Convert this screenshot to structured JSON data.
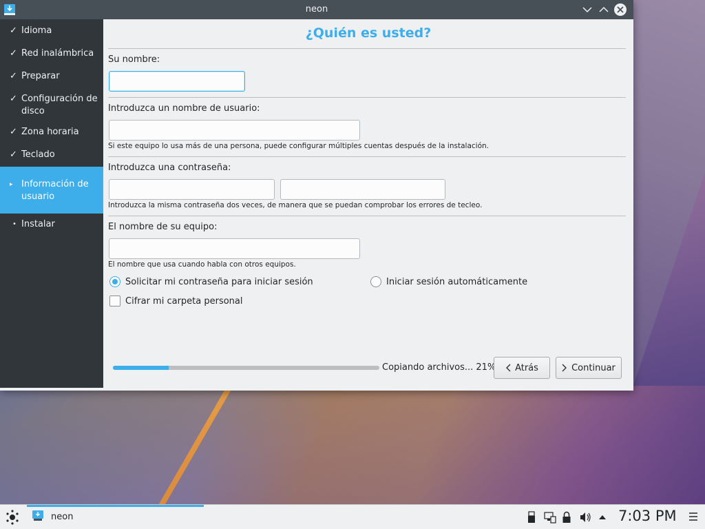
{
  "window": {
    "title": "neon"
  },
  "sidebar": {
    "steps": [
      {
        "label": "Idioma",
        "mark": "✓"
      },
      {
        "label": "Red inalámbrica",
        "mark": "✓"
      },
      {
        "label": "Preparar",
        "mark": "✓"
      },
      {
        "label": "Configuración de disco",
        "mark": "✓"
      },
      {
        "label": "Zona horaria",
        "mark": "✓"
      },
      {
        "label": "Teclado",
        "mark": "✓"
      },
      {
        "label": "Información de usuario",
        "mark": "▸"
      },
      {
        "label": "Instalar",
        "mark": "•"
      }
    ]
  },
  "page": {
    "heading": "¿Quién es usted?",
    "name_label": "Su nombre:",
    "name_value": "",
    "username_label": "Introduzca un nombre de usuario:",
    "username_value": "",
    "username_hint": "Si este equipo lo usa más de una persona, puede configurar múltiples cuentas después de la instalación.",
    "password_label": "Introduzca una contraseña:",
    "password_value": "",
    "password_confirm_value": "",
    "password_hint": "Introduzca la misma contraseña dos veces, de manera que se puedan comprobar los errores de tecleo.",
    "hostname_label": "El nombre de su equipo:",
    "hostname_value": "",
    "hostname_hint": "El nombre que usa cuando habla con otros equipos.",
    "radio_ask_password": "Solicitar mi contraseña para iniciar sesión",
    "radio_autologin": "Iniciar sesión automáticamente",
    "checkbox_encrypt": "Cifrar mi carpeta personal",
    "ask_password_selected": true,
    "encrypt_checked": false
  },
  "footer": {
    "progress_text": "Copiando archivos... 21%",
    "progress_fraction": 0.21,
    "back_label": "Atrás",
    "next_label": "Continuar"
  },
  "taskbar": {
    "task_label": "neon",
    "clock": "7:03 PM"
  },
  "colors": {
    "accent": "#3daee9",
    "sidebar_bg": "#31363b",
    "titlebar_bg": "#475057",
    "window_bg": "#eff0f1"
  },
  "icons": {
    "app": "installer-icon",
    "minimize": "chevron-down-icon",
    "maximize": "chevron-up-icon",
    "close": "close-icon",
    "launcher": "neon-launcher-icon",
    "tray": [
      "usb-icon",
      "network-icon",
      "lock-icon",
      "volume-icon",
      "expand-tray-icon"
    ],
    "menu": "hamburger-menu-icon"
  }
}
